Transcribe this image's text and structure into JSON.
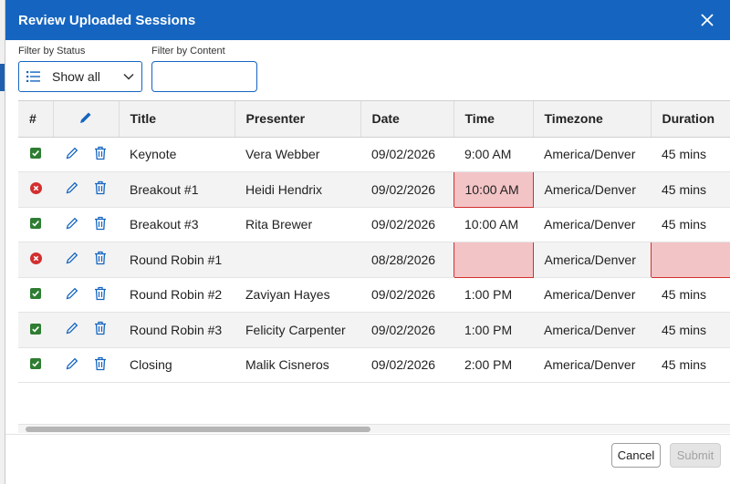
{
  "dialog": {
    "title": "Review Uploaded Sessions"
  },
  "filters": {
    "status_label": "Filter by Status",
    "status_value": "Show all",
    "content_label": "Filter by Content",
    "content_value": ""
  },
  "table": {
    "columns": [
      "#",
      "",
      "Title",
      "Presenter",
      "Date",
      "Time",
      "Timezone",
      "Duration"
    ],
    "rows": [
      {
        "status": "ok",
        "title": "Keynote",
        "presenter": "Vera Webber",
        "date": "09/02/2026",
        "time": "9:00 AM",
        "timezone": "America/Denver",
        "duration": "45 mins"
      },
      {
        "status": "error",
        "title": "Breakout #1",
        "presenter": "Heidi Hendrix",
        "date": "09/02/2026",
        "time": "10:00 AM",
        "timezone": "America/Denver",
        "duration": "45 mins"
      },
      {
        "status": "ok",
        "title": "Breakout #3",
        "presenter": "Rita Brewer",
        "date": "09/02/2026",
        "time": "10:00 AM",
        "timezone": "America/Denver",
        "duration": "45 mins"
      },
      {
        "status": "error",
        "title": "Round Robin #1",
        "presenter": "",
        "date": "08/28/2026",
        "time": "",
        "timezone": "America/Denver",
        "duration": ""
      },
      {
        "status": "ok",
        "title": "Round Robin #2",
        "presenter": "Zaviyan Hayes",
        "date": "09/02/2026",
        "time": "1:00 PM",
        "timezone": "America/Denver",
        "duration": "45 mins"
      },
      {
        "status": "ok",
        "title": "Round Robin #3",
        "presenter": "Felicity Carpenter",
        "date": "09/02/2026",
        "time": "1:00 PM",
        "timezone": "America/Denver",
        "duration": "45 mins"
      },
      {
        "status": "ok",
        "title": "Closing",
        "presenter": "Malik Cisneros",
        "date": "09/02/2026",
        "time": "2:00 PM",
        "timezone": "America/Denver",
        "duration": "45 mins"
      }
    ]
  },
  "footer": {
    "cancel_label": "Cancel",
    "submit_label": "Submit"
  },
  "colors": {
    "titlebar": "#1565c0",
    "ok": "#2e7d32",
    "error": "#d32f2f",
    "error_fill": "#f3c4c6",
    "icon_blue": "#1565c0"
  },
  "icons": {
    "close": "close-icon",
    "list": "list-icon",
    "chevron": "chevron-down-icon",
    "edit": "pencil-icon",
    "delete": "trash-icon",
    "ok": "check-icon",
    "error": "x-circle-icon"
  }
}
